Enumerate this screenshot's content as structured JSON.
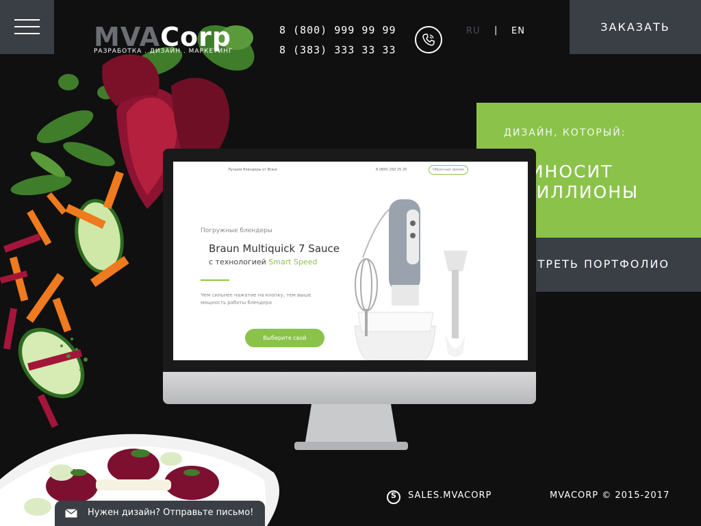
{
  "header": {
    "logo": {
      "part1": "MVA",
      "part2": "Corp",
      "tagline": "РАЗРАБОТКА . ДИЗАЙН . МАРКЕТИНГ"
    },
    "phones": [
      "8 (800) 999 99 99",
      "8 (383) 333 33 33"
    ],
    "languages": {
      "ru": "RU",
      "separator": "|",
      "en": "EN"
    },
    "order_label": "ЗАКАЗАТЬ"
  },
  "promo": {
    "subtitle": "ДИЗАЙН, КОТОРЫЙ:",
    "line1": "- ПРИНОСИТ",
    "line2": "МИЛЛИОНЫ",
    "portfolio_label": "СМОТРЕТЬ ПОРТФОЛИО"
  },
  "screen": {
    "top_text": "Лучшие блендеры от Braun",
    "phone": "8 (800) 250 25 25",
    "callback": "Обратный звонок",
    "category": "Погружные блендеры",
    "title": "Braun Multiquick 7 Sauce",
    "subtitle_prefix": "с технологией ",
    "subtitle_highlight": "Smart Speed",
    "description": "Чем сильнее нажатие на кнопку, тем выше мощность работы блендера",
    "button": "Выберите свой"
  },
  "footer": {
    "skype": "SALES.MVACORP",
    "copyright": "MVACORP © 2015-2017",
    "mail_prompt": "Нужен дизайн? Отправьте письмо!"
  },
  "colors": {
    "accent": "#8bc34a",
    "panel": "#3a3e45",
    "background": "#101010"
  }
}
